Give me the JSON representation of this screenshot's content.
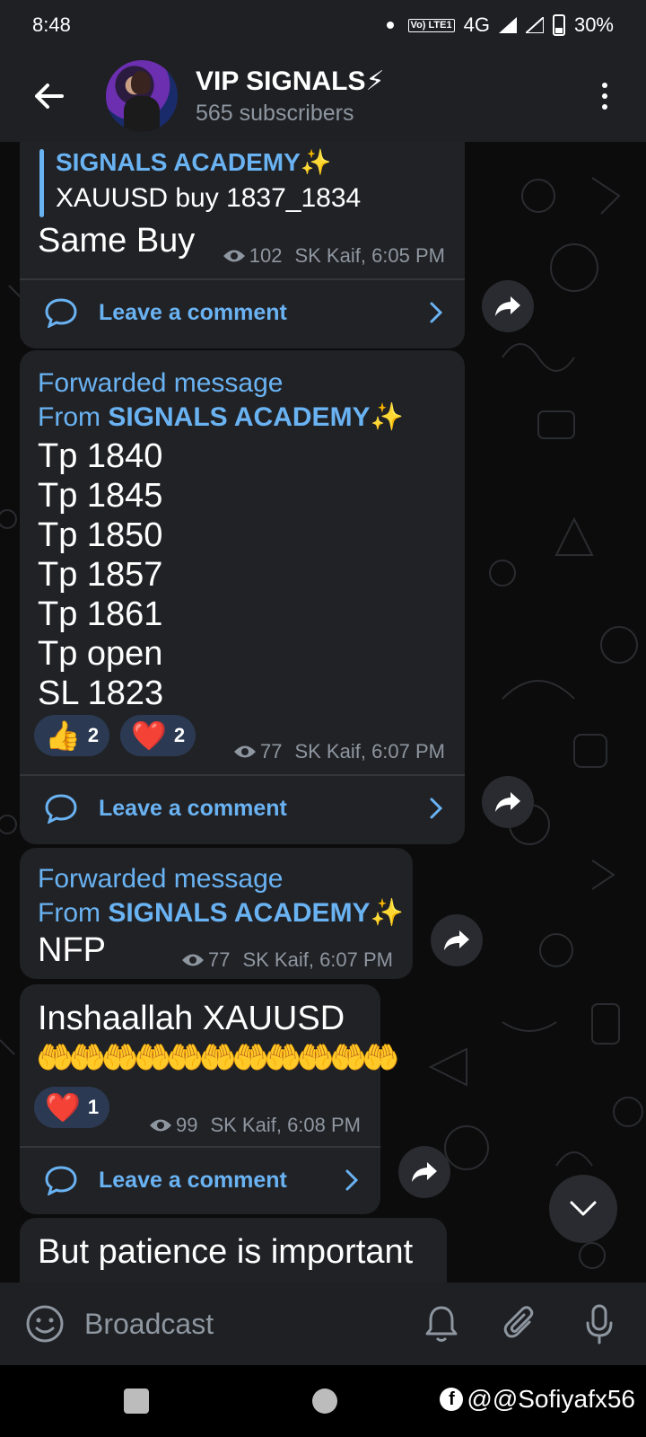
{
  "status_bar": {
    "time": "8:48",
    "network_badge": "Vo) LTE1",
    "network": "4G",
    "battery": "30%"
  },
  "header": {
    "title": "VIP SIGNALS⚡",
    "subscribers": "565 subscribers"
  },
  "messages": [
    {
      "reply_author": "SIGNALS ACADEMY✨",
      "reply_text": "XAUUSD buy 1837_1834",
      "text": "Same Buy",
      "views": "102",
      "meta": "SK Kaif, 6:05 PM",
      "comment_label": "Leave a comment"
    },
    {
      "forward_label": "Forwarded message",
      "from_prefix": "From ",
      "from_name": "SIGNALS ACADEMY✨",
      "lines": [
        "Tp 1840",
        "Tp 1845",
        "Tp 1850",
        "Tp 1857",
        "Tp 1861",
        "Tp open",
        "SL 1823"
      ],
      "reactions": [
        {
          "emoji": "👍",
          "count": "2"
        },
        {
          "emoji": "❤️",
          "count": "2"
        }
      ],
      "views": "77",
      "meta": "SK Kaif, 6:07 PM",
      "comment_label": "Leave a comment"
    },
    {
      "forward_label": "Forwarded message",
      "from_prefix": "From ",
      "from_name": "SIGNALS ACADEMY✨",
      "text": "NFP",
      "views": "77",
      "meta": "SK Kaif, 6:07 PM"
    },
    {
      "text": "Inshaallah XAUUSD",
      "emoji_line": "🤲🤲🤲🤲🤲🤲🤲🤲🤲🤲🤲",
      "reactions": [
        {
          "emoji": "❤️",
          "count": "1"
        }
      ],
      "views": "99",
      "meta": "SK Kaif, 6:08 PM",
      "comment_label": "Leave a comment"
    },
    {
      "text": "But patience is important"
    }
  ],
  "input": {
    "placeholder": "Broadcast"
  },
  "watermark": "@@Sofiyafx56",
  "icons": [
    "back-arrow-icon",
    "more-vert-icon",
    "eye-icon",
    "comment-icon",
    "chevron-right-icon",
    "share-icon",
    "chevron-down-icon",
    "emoji-icon",
    "bell-icon",
    "attach-icon",
    "mic-icon"
  ],
  "colors": {
    "accent": "#6ab3f3",
    "bubble": "#212226",
    "bar": "#1e2024",
    "reaction_bg": "#2b3a52"
  }
}
